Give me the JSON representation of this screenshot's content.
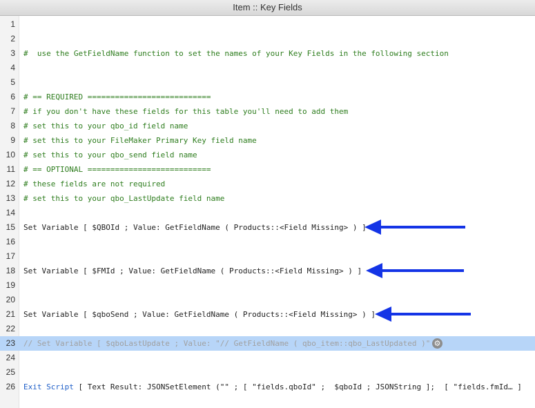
{
  "window": {
    "title": "Item :: Key Fields"
  },
  "colors": {
    "comment": "#2e7d1e",
    "keyword": "#1f5fc8",
    "disabled": "#a0a0a0",
    "selection": "#b7d5f8",
    "arrow": "#1434e6"
  },
  "icons": {
    "step_options": "gear-icon",
    "annotation": "arrow-left-icon"
  },
  "lines": [
    {
      "n": "1",
      "parts": []
    },
    {
      "n": "2",
      "parts": []
    },
    {
      "n": "3",
      "parts": [
        {
          "t": "#  use the GetFieldName function to set the names of your Key Fields in the following section",
          "c": "comment"
        }
      ]
    },
    {
      "n": "4",
      "parts": []
    },
    {
      "n": "5",
      "parts": []
    },
    {
      "n": "6",
      "parts": [
        {
          "t": "# == REQUIRED ===========================",
          "c": "comment"
        }
      ]
    },
    {
      "n": "7",
      "parts": [
        {
          "t": "# if you don't have these fields for this table you'll need to add them",
          "c": "comment"
        }
      ]
    },
    {
      "n": "8",
      "parts": [
        {
          "t": "# set this to your qbo_id field name",
          "c": "comment"
        }
      ]
    },
    {
      "n": "9",
      "parts": [
        {
          "t": "# set this to your FileMaker Primary Key field name",
          "c": "comment"
        }
      ]
    },
    {
      "n": "10",
      "parts": [
        {
          "t": "# set this to your qbo_send field name",
          "c": "comment"
        }
      ]
    },
    {
      "n": "11",
      "parts": [
        {
          "t": "# == OPTIONAL ===========================",
          "c": "comment"
        }
      ]
    },
    {
      "n": "12",
      "parts": [
        {
          "t": "# these fields are not required",
          "c": "comment"
        }
      ]
    },
    {
      "n": "13",
      "parts": [
        {
          "t": "# set this to your qbo_LastUpdate field name",
          "c": "comment"
        }
      ]
    },
    {
      "n": "14",
      "parts": []
    },
    {
      "n": "15",
      "parts": [
        {
          "t": "Set Variable [ $QBOId ; Value: GetFieldName ( Products::<Field Missing> ) ]",
          "c": "normal"
        }
      ]
    },
    {
      "n": "16",
      "parts": []
    },
    {
      "n": "17",
      "parts": []
    },
    {
      "n": "18",
      "parts": [
        {
          "t": "Set Variable [ $FMId ; Value: GetFieldName ( Products::<Field Missing> ) ]",
          "c": "normal"
        }
      ]
    },
    {
      "n": "19",
      "parts": []
    },
    {
      "n": "20",
      "parts": []
    },
    {
      "n": "21",
      "parts": [
        {
          "t": "Set Variable [ $qboSend ; Value: GetFieldName ( Products::<Field Missing> ) ]",
          "c": "normal"
        }
      ]
    },
    {
      "n": "22",
      "parts": []
    },
    {
      "n": "23",
      "parts": [
        {
          "t": "// Set Variable [ $qboLastUpdate ; Value: \"// GetFieldName ( qbo_item::qbo_LastUpdated )\" ]",
          "c": "disabled"
        }
      ],
      "selected": true,
      "gear": true
    },
    {
      "n": "24",
      "parts": []
    },
    {
      "n": "25",
      "parts": []
    },
    {
      "n": "26",
      "parts": [
        {
          "t": "Exit Script",
          "c": "kw"
        },
        {
          "t": " [ Text Result: JSONSetElement (\"\" ; [ \"fields.qboId\" ;  $qboId ; JSONString ];  [ \"fields.fmId… ]",
          "c": "normal"
        }
      ]
    }
  ]
}
